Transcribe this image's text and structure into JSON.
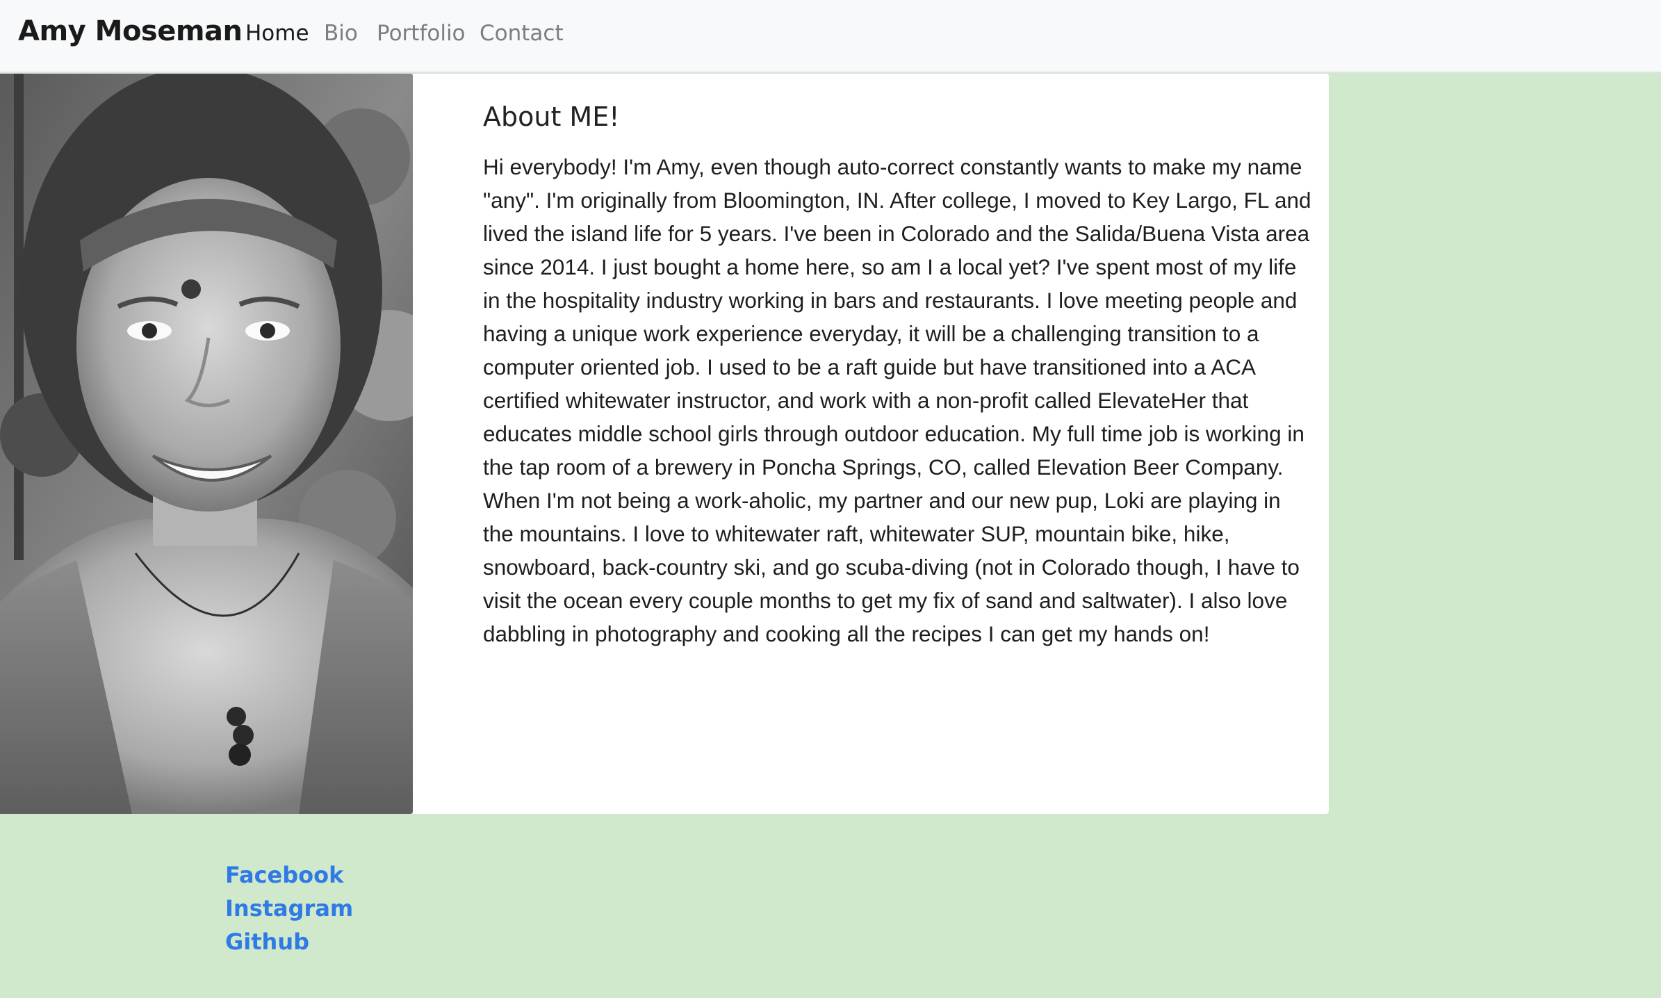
{
  "navbar": {
    "brand": "Amy Moseman",
    "links": [
      {
        "label": "Home",
        "active": true
      },
      {
        "label": "Bio",
        "active": false
      },
      {
        "label": "Portfolio",
        "active": false
      },
      {
        "label": "Contact",
        "active": false
      }
    ]
  },
  "about": {
    "title": "About ME!",
    "text": "Hi everybody! I'm Amy, even though auto-correct constantly wants to make my name \"any\". I'm originally from Bloomington, IN. After college, I moved to Key Largo, FL and lived the island life for 5 years. I've been in Colorado and the Salida/Buena Vista area since 2014. I just bought a home here, so am I a local yet? I've spent most of my life in the hospitality industry working in bars and restaurants. I love meeting people and having a unique work experience everyday, it will be a challenging transition to a computer oriented job. I used to be a raft guide but have transitioned into a ACA certified whitewater instructor, and work with a non-profit called ElevateHer that educates middle school girls through outdoor education. My full time job is working in the tap room of a brewery in Poncha Springs, CO, called Elevation Beer Company. When I'm not being a work-aholic, my partner and our new pup, Loki are playing in the mountains. I love to whitewater raft, whitewater SUP, mountain bike, hike, snowboard, back-country ski, and go scuba-diving (not in Colorado though, I have to visit the ocean every couple months to get my fix of sand and saltwater). I also love dabbling in photography and cooking all the recipes I can get my hands on!"
  },
  "social": {
    "facebook": "Facebook",
    "instagram": "Instagram",
    "github": "Github"
  },
  "colors": {
    "page_bg": "#d0e8cb",
    "navbar_bg": "#f8f9fa",
    "link": "#2f7ae5",
    "card_bg": "#ffffff"
  }
}
